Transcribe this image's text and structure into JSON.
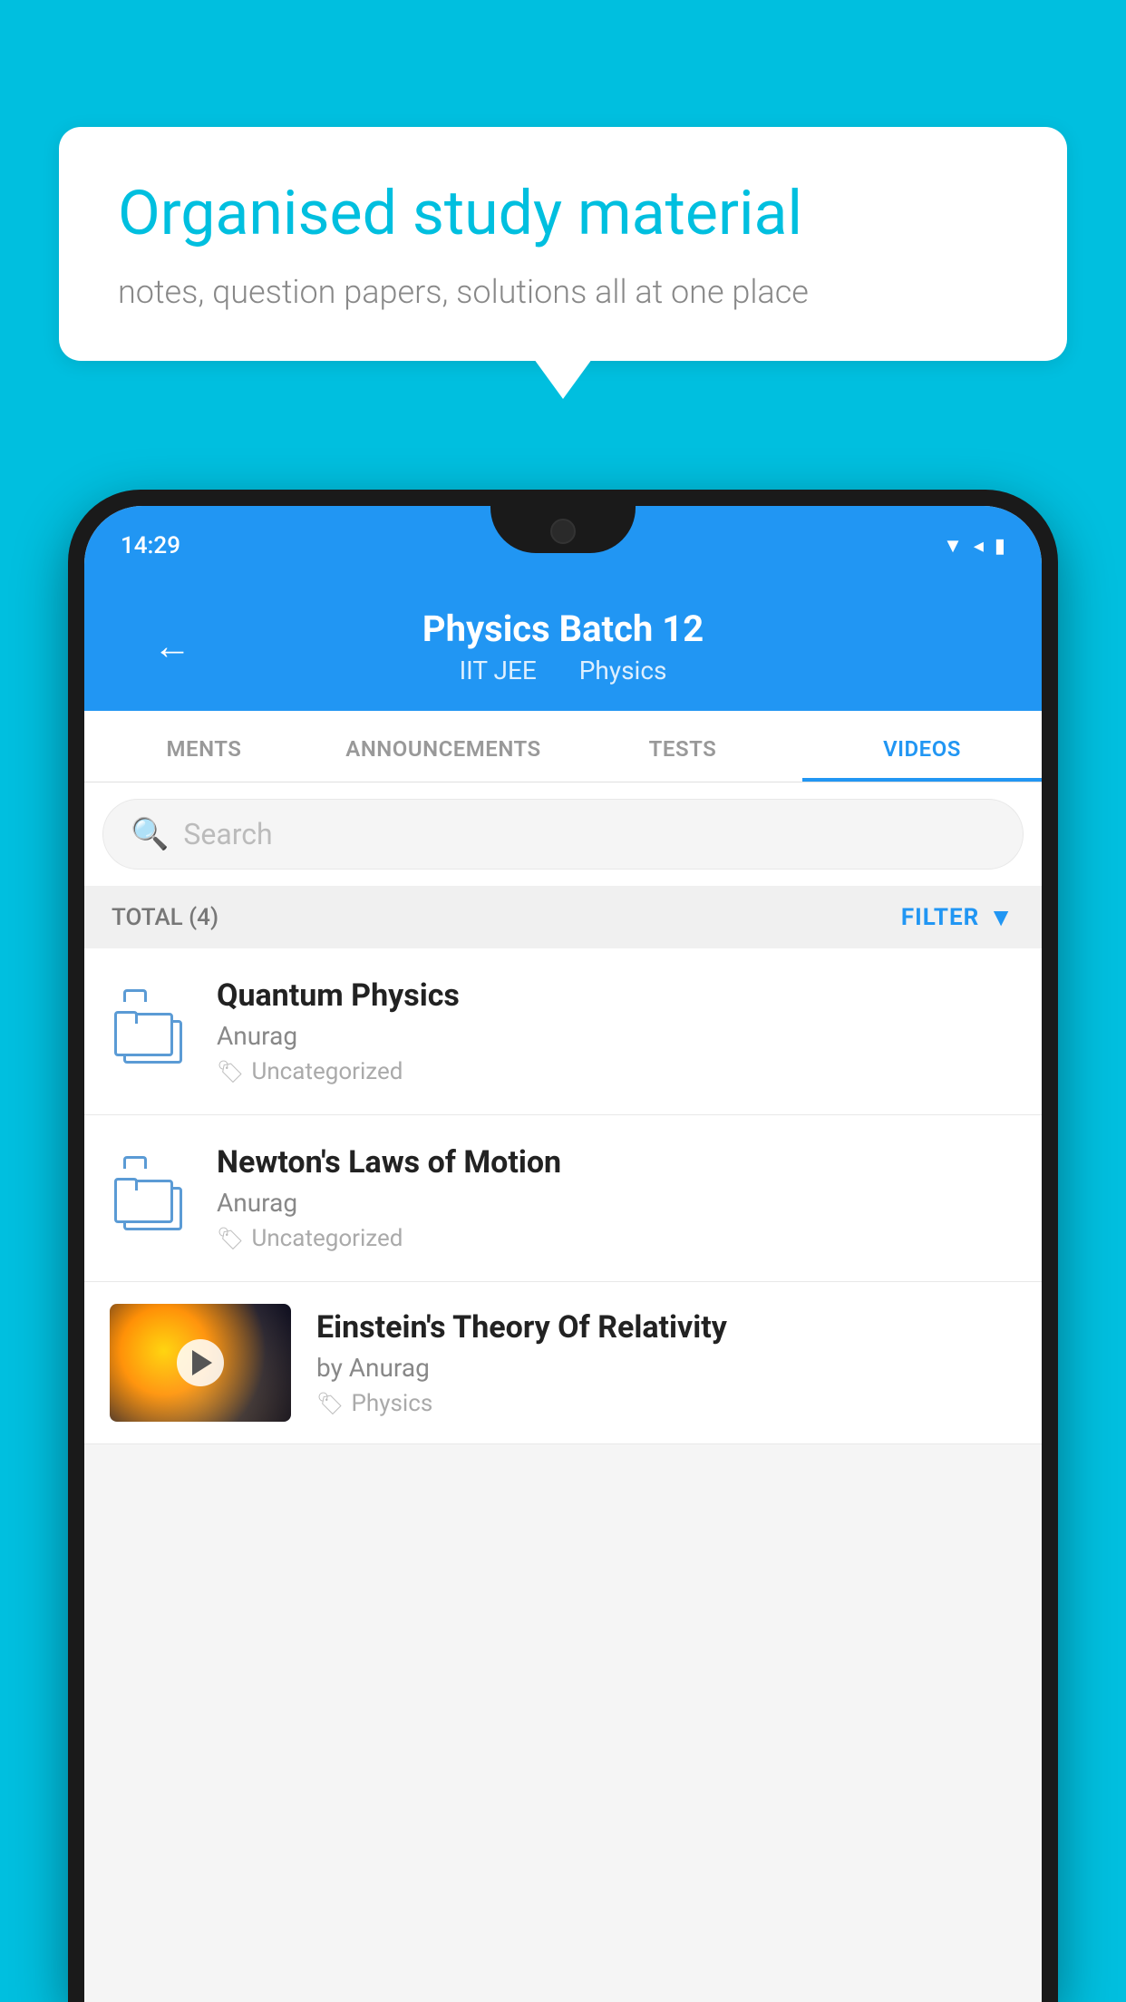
{
  "background_color": "#00BFDF",
  "speech_bubble": {
    "title": "Organised study material",
    "subtitle": "notes, question papers, solutions all at one place"
  },
  "status_bar": {
    "time": "14:29",
    "icons": [
      "wifi",
      "signal",
      "battery"
    ]
  },
  "header": {
    "title": "Physics Batch 12",
    "subtitle1": "IIT JEE",
    "subtitle2": "Physics",
    "back_label": "←"
  },
  "tabs": [
    {
      "label": "MENTS",
      "active": false
    },
    {
      "label": "ANNOUNCEMENTS",
      "active": false
    },
    {
      "label": "TESTS",
      "active": false
    },
    {
      "label": "VIDEOS",
      "active": true
    }
  ],
  "search": {
    "placeholder": "Search"
  },
  "filter_bar": {
    "total_label": "TOTAL (4)",
    "filter_label": "FILTER"
  },
  "list_items": [
    {
      "type": "folder",
      "title": "Quantum Physics",
      "author": "Anurag",
      "tag": "Uncategorized"
    },
    {
      "type": "folder",
      "title": "Newton's Laws of Motion",
      "author": "Anurag",
      "tag": "Uncategorized"
    }
  ],
  "video_item": {
    "title": "Einstein's Theory Of Relativity",
    "author": "by Anurag",
    "tag": "Physics"
  }
}
